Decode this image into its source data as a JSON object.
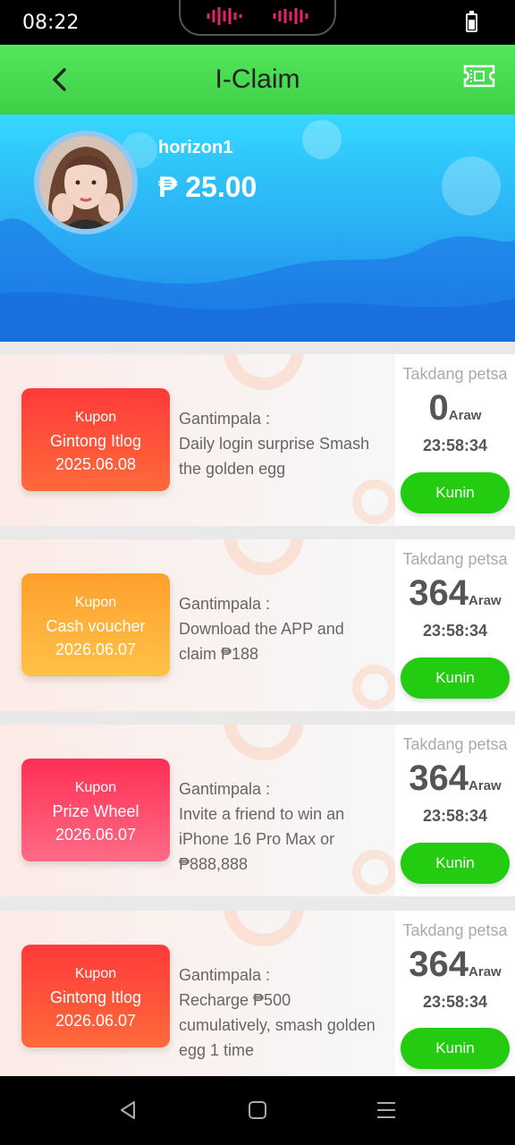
{
  "status": {
    "time": "08:22"
  },
  "header": {
    "title": "I-Claim"
  },
  "profile": {
    "username": "horizon1",
    "balance": "₱ 25.00"
  },
  "coupons": [
    {
      "tag": "Kupon",
      "name": "Gintong Itlog",
      "date": "2025.06.08",
      "desc_label": "Gantimpala :",
      "desc": "Daily login surprise Smash the golden egg",
      "left_label": "Takdang petsa",
      "days": "0",
      "days_unit": "Araw",
      "time_left": "23:58:34",
      "button": "Kunin",
      "color_top": "#ff3a3a",
      "color_bottom": "#ff6a3a"
    },
    {
      "tag": "Kupon",
      "name": "Cash voucher",
      "date": "2026.06.07",
      "desc_label": "Gantimpala :",
      "desc": "Download the APP and claim ₱188",
      "left_label": "Takdang petsa",
      "days": "364",
      "days_unit": "Araw",
      "time_left": "23:58:34",
      "button": "Kunin",
      "color_top": "#ff9f2e",
      "color_bottom": "#ffc247"
    },
    {
      "tag": "Kupon",
      "name": "Prize Wheel",
      "date": "2026.06.07",
      "desc_label": "Gantimpala :",
      "desc": "Invite a friend to win an iPhone 16 Pro Max or ₱888,888",
      "left_label": "Takdang petsa",
      "days": "364",
      "days_unit": "Araw",
      "time_left": "23:58:34",
      "button": "Kunin",
      "color_top": "#ff2f55",
      "color_bottom": "#ff6b86"
    },
    {
      "tag": "Kupon",
      "name": "Gintong Itlog",
      "date": "2026.06.07",
      "desc_label": "Gantimpala :",
      "desc": "Recharge ₱500 cumulatively, smash golden egg 1 time",
      "left_label": "Takdang petsa",
      "days": "364",
      "days_unit": "Araw",
      "time_left": "23:58:34",
      "button": "Kunin",
      "color_top": "#ff3a3a",
      "color_bottom": "#ff6a3a"
    }
  ]
}
